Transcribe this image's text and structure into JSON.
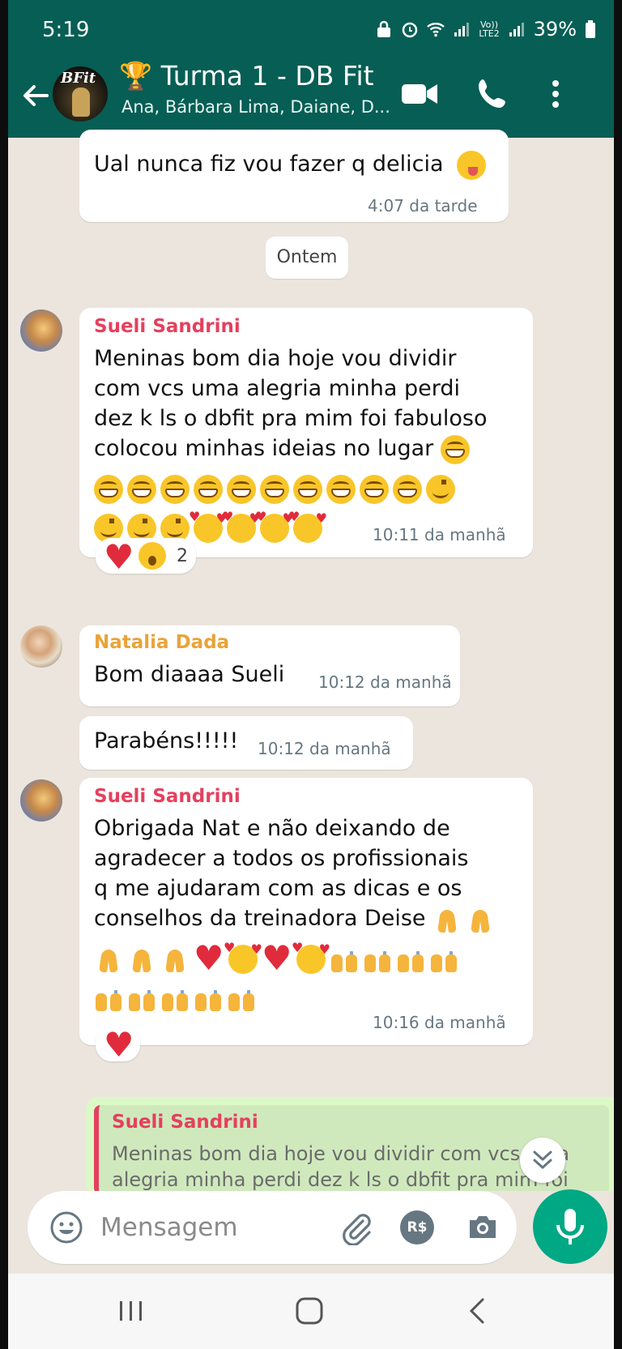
{
  "status_bar": {
    "time": "5:19",
    "volte": "Vo))",
    "lte": "LTE2",
    "battery": "39%"
  },
  "header": {
    "group_name": "🏆 Turma 1 - DB Fit",
    "participants": "Ana, Bárbara Lima, Daiane, D...",
    "avatar_logo": "BFit"
  },
  "chat": {
    "date_divider": "Ontem",
    "messages": [
      {
        "text": "Ual nunca fiz vou fazer q delicia",
        "emojis": [
          "tongue"
        ],
        "time": "4:07 da tarde"
      },
      {
        "sender": "Sueli Sandrini",
        "sender_color": "#e5405e",
        "lines": [
          "Meninas bom dia hoje vou dividir",
          "com vcs uma alegria minha perdi",
          "dez k ls o dbfit pra mim foi fabuloso",
          "colocou minhas ideias no lugar"
        ],
        "emojis_inline": [
          "grin"
        ],
        "emojis_row1": [
          "grin",
          "grin",
          "grin",
          "grin",
          "grin",
          "grin",
          "grin",
          "grin",
          "grin",
          "grin",
          "smile"
        ],
        "emojis_row2": [
          "smile",
          "smile",
          "smile",
          "hearts",
          "hearts",
          "hearts",
          "hearts"
        ],
        "time": "10:11 da manhã",
        "reactions": {
          "emojis": [
            "heart",
            "wow"
          ],
          "count": "2"
        }
      },
      {
        "sender": "Natalia Dada",
        "sender_color": "#e9a33a",
        "text": "Bom diaaaa Sueli",
        "time": "10:12 da manhã"
      },
      {
        "text": "Parabéns!!!!!",
        "time": "10:12 da manhã"
      },
      {
        "sender": "Sueli Sandrini",
        "sender_color": "#e5405e",
        "lines": [
          "Obrigada Nat e não deixando de",
          "agradecer a todos os profissionais",
          "q me ajudaram com as dicas e os",
          "conselhos da treinadora Deise"
        ],
        "emojis_inline": [
          "pray",
          "pray"
        ],
        "emojis_row1": [
          "pray",
          "pray",
          "pray",
          "heart",
          "hearts",
          "heart",
          "hearts",
          "raise",
          "raise",
          "raise",
          "raise"
        ],
        "emojis_row2": [
          "raise",
          "raise",
          "raise",
          "raise",
          "raise"
        ],
        "time": "10:16 da manhã",
        "reactions": {
          "emojis": [
            "heart"
          ]
        }
      }
    ],
    "reply_preview": {
      "sender": "Sueli Sandrini",
      "line1": "Meninas bom dia hoje vou dividir com vcs uma",
      "line2": "alegria minha perdi dez k ls o dbfit pra mim foi"
    }
  },
  "input": {
    "placeholder": "Mensagem",
    "currency_label": "R$"
  },
  "colors": {
    "header": "#075e54",
    "chat_bg": "#ece5dd",
    "accent": "#00a884"
  }
}
